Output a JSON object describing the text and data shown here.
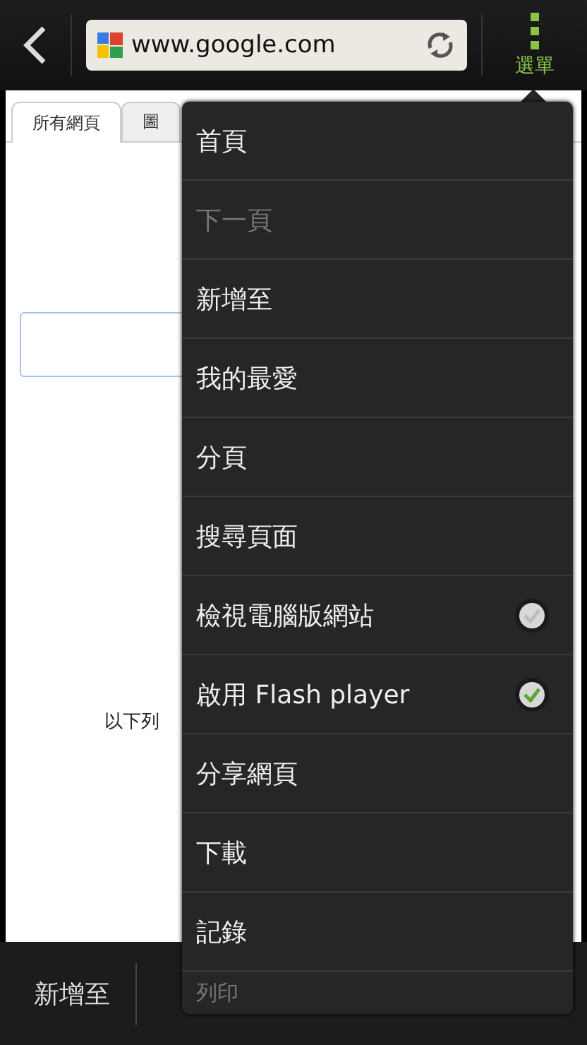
{
  "toolbar": {
    "url": "www.google.com",
    "menu_label": "選單"
  },
  "page": {
    "tabs": [
      {
        "label": "所有網頁",
        "selected": true
      },
      {
        "label": "圖",
        "selected": false
      }
    ],
    "text": "以下列"
  },
  "bottom_bar": {
    "items": [
      "新增至"
    ]
  },
  "menu": {
    "items": [
      {
        "label": "首頁",
        "kind": "plain",
        "disabled": false
      },
      {
        "label": "下一頁",
        "kind": "plain",
        "disabled": true
      },
      {
        "label": "新增至",
        "kind": "plain",
        "disabled": false
      },
      {
        "label": "我的最愛",
        "kind": "plain",
        "disabled": false
      },
      {
        "label": "分頁",
        "kind": "plain",
        "disabled": false
      },
      {
        "label": "搜尋頁面",
        "kind": "plain",
        "disabled": false
      },
      {
        "label": "檢視電腦版網站",
        "kind": "check",
        "disabled": false,
        "checked": false
      },
      {
        "label": "啟用 Flash player",
        "kind": "check",
        "disabled": false,
        "checked": true
      },
      {
        "label": "分享網頁",
        "kind": "plain",
        "disabled": false
      },
      {
        "label": "下載",
        "kind": "plain",
        "disabled": false
      },
      {
        "label": "記錄",
        "kind": "plain",
        "disabled": false
      },
      {
        "label": "列印",
        "kind": "plain",
        "disabled": true
      }
    ]
  }
}
